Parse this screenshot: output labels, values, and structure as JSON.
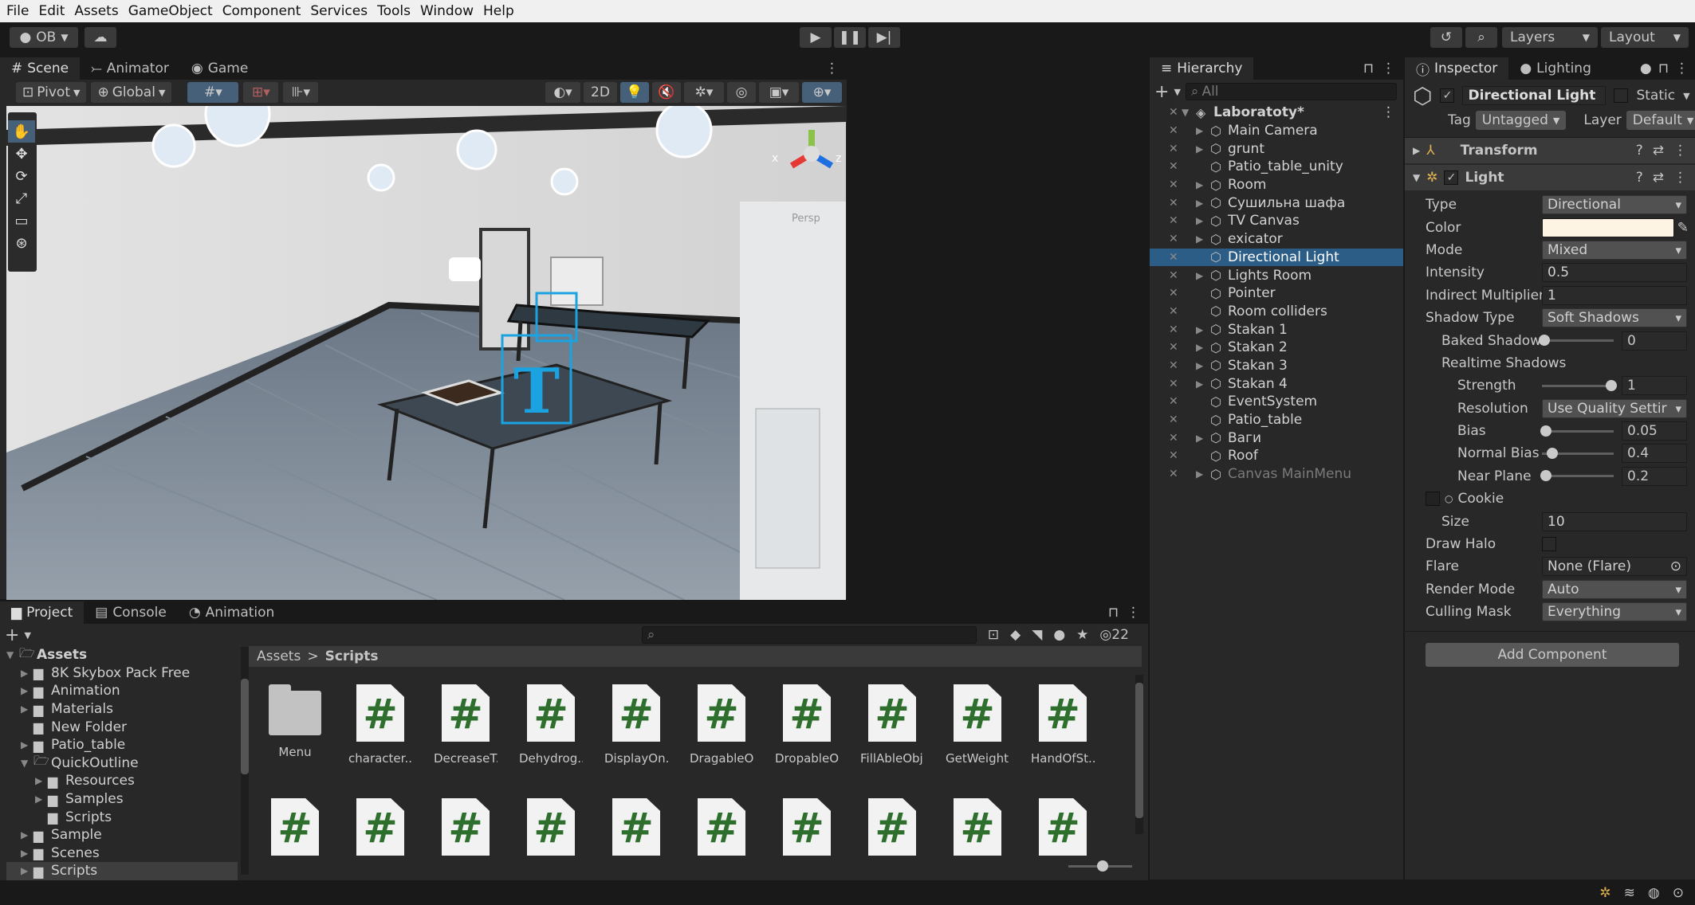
{
  "menu": [
    "File",
    "Edit",
    "Assets",
    "GameObject",
    "Component",
    "Services",
    "Tools",
    "Window",
    "Help"
  ],
  "toolbar": {
    "account": "OB",
    "layers": "Layers",
    "layout": "Layout"
  },
  "scene_tabs": [
    "Scene",
    "Animator",
    "Game"
  ],
  "scene_toolbar": {
    "pivot": "Pivot",
    "global": "Global",
    "mode2d": "2D"
  },
  "hierarchy": {
    "tab": "Hierarchy",
    "search_placeholder": "All",
    "root": "Laboratoty*",
    "items": [
      {
        "label": "Main Camera",
        "arrow": "▶"
      },
      {
        "label": "grunt",
        "arrow": "▶"
      },
      {
        "label": "Patio_table_unity",
        "arrow": ""
      },
      {
        "label": "Room",
        "arrow": "▶"
      },
      {
        "label": "Сушильна шафа",
        "arrow": "▶"
      },
      {
        "label": "TV Canvas",
        "arrow": "▶"
      },
      {
        "label": "exicator",
        "arrow": "▶"
      },
      {
        "label": "Directional Light",
        "arrow": ""
      },
      {
        "label": "Lights Room",
        "arrow": "▶"
      },
      {
        "label": "Pointer",
        "arrow": ""
      },
      {
        "label": "Room colliders",
        "arrow": ""
      },
      {
        "label": "Stakan 1",
        "arrow": "▶"
      },
      {
        "label": "Stakan 2",
        "arrow": "▶"
      },
      {
        "label": "Stakan 3",
        "arrow": "▶"
      },
      {
        "label": "Stakan 4",
        "arrow": "▶"
      },
      {
        "label": "EventSystem",
        "arrow": ""
      },
      {
        "label": "Patio_table",
        "arrow": ""
      },
      {
        "label": "Ваги",
        "arrow": "▶"
      },
      {
        "label": "Roof",
        "arrow": ""
      },
      {
        "label": "Canvas MainMenu",
        "arrow": "▶"
      }
    ]
  },
  "inspector": {
    "tabs": [
      "Inspector",
      "Lighting"
    ],
    "object_name": "Directional Light",
    "static_label": "Static",
    "tag_label": "Tag",
    "tag_value": "Untagged",
    "layer_label": "Layer",
    "layer_value": "Default",
    "transform": "Transform",
    "light": "Light",
    "props": [
      {
        "label": "Type",
        "value": "Directional",
        "kind": "dd"
      },
      {
        "label": "Color",
        "value": "",
        "kind": "color"
      },
      {
        "label": "Mode",
        "value": "Mixed",
        "kind": "dd"
      },
      {
        "label": "Intensity",
        "value": "0.5",
        "kind": "field"
      },
      {
        "label": "Indirect Multiplier",
        "value": "1",
        "kind": "field"
      },
      {
        "label": "Shadow Type",
        "value": "Soft Shadows",
        "kind": "dd"
      }
    ],
    "baked_label": "Baked Shadow Ar",
    "baked_value": "0",
    "realtime_label": "Realtime Shadows",
    "strength_label": "Strength",
    "strength_value": "1",
    "resolution_label": "Resolution",
    "resolution_value": "Use Quality Settir",
    "bias_label": "Bias",
    "bias_value": "0.05",
    "normal_bias_label": "Normal Bias",
    "normal_bias_value": "0.4",
    "near_plane_label": "Near Plane",
    "near_plane_value": "0.2",
    "cookie_label": "Cookie",
    "size_label": "Size",
    "size_value": "10",
    "draw_halo_label": "Draw Halo",
    "flare_label": "Flare",
    "flare_value": "None (Flare)",
    "render_mode_label": "Render Mode",
    "render_mode_value": "Auto",
    "culling_label": "Culling Mask",
    "culling_value": "Everything",
    "add_component": "Add Component"
  },
  "project": {
    "tabs": [
      "Project",
      "Console",
      "Animation"
    ],
    "hidden_count": "22",
    "breadcrumb_root": "Assets",
    "breadcrumb_sep": ">",
    "breadcrumb_current": "Scripts",
    "tree": [
      {
        "label": "Assets",
        "indent": 0,
        "arrow": "▼",
        "open": true
      },
      {
        "label": "8K Skybox Pack Free",
        "indent": 1,
        "arrow": "▶"
      },
      {
        "label": "Animation",
        "indent": 1,
        "arrow": "▶"
      },
      {
        "label": "Materials",
        "indent": 1,
        "arrow": "▶"
      },
      {
        "label": "New Folder",
        "indent": 1,
        "arrow": ""
      },
      {
        "label": "Patio_table",
        "indent": 1,
        "arrow": "▶"
      },
      {
        "label": "QuickOutline",
        "indent": 1,
        "arrow": "▼",
        "open": true
      },
      {
        "label": "Resources",
        "indent": 2,
        "arrow": "▶"
      },
      {
        "label": "Samples",
        "indent": 2,
        "arrow": "▶"
      },
      {
        "label": "Scripts",
        "indent": 2,
        "arrow": ""
      },
      {
        "label": "Sample",
        "indent": 1,
        "arrow": "▶"
      },
      {
        "label": "Scenes",
        "indent": 1,
        "arrow": "▶"
      },
      {
        "label": "Scripts",
        "indent": 1,
        "arrow": "▶",
        "sel": true
      }
    ],
    "files": [
      "Menu",
      "character...",
      "DecreaseT...",
      "Dehydrog...",
      "DisplayOn...",
      "DragableO...",
      "DropableO...",
      "FillAbleObj...",
      "GetWeight...",
      "HandOfSt..."
    ]
  },
  "scene_labels": {
    "x_axis": "x",
    "z_axis": "z",
    "persp": "Persp"
  },
  "colors": {
    "selection": "#2c5d87",
    "light_color": "#fdf4e3",
    "script_hash": "#2e6f2e"
  }
}
